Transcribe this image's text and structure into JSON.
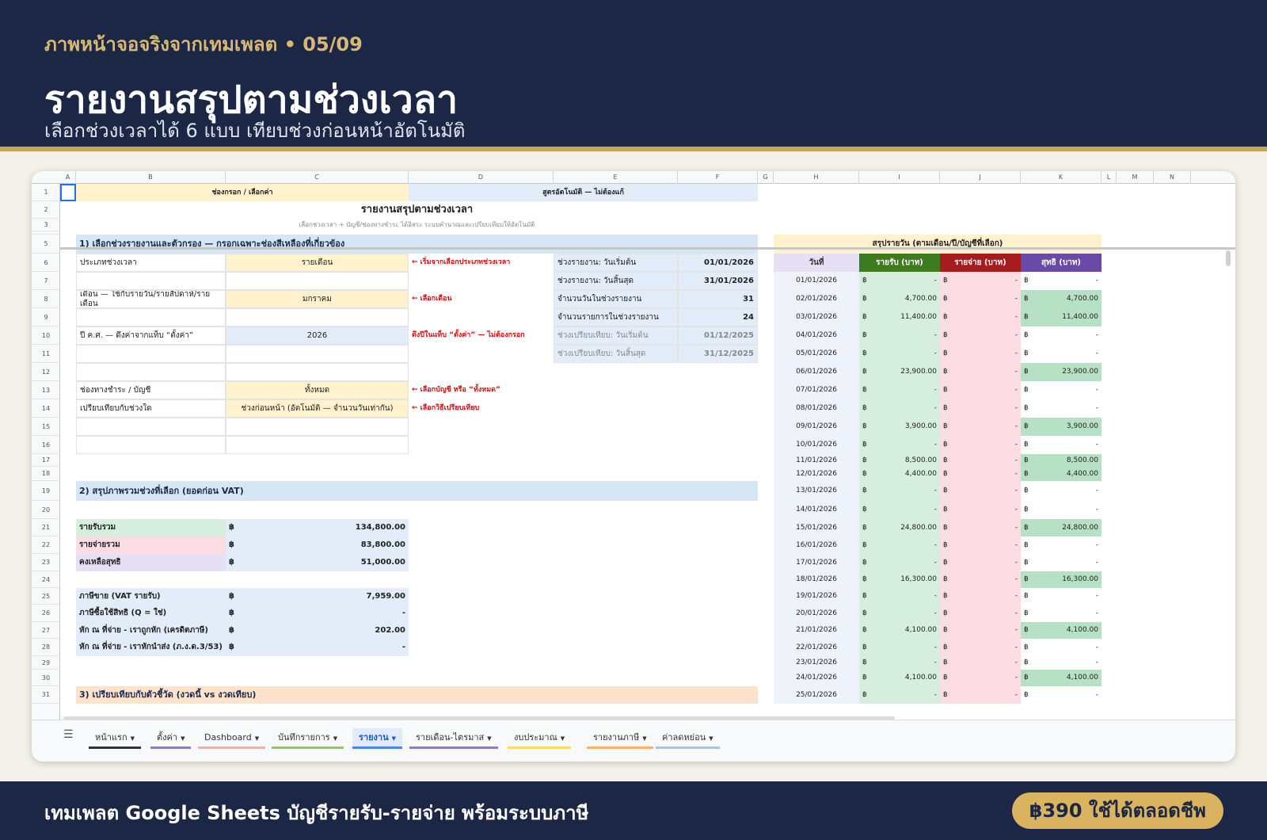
{
  "header": {
    "subtitle": "ภาพหน้าจอจริงจากเทมเพลต",
    "dot": "•",
    "page": "05/09",
    "title": "รายงานสรุปตามช่วงเวลา",
    "desc": "เลือกช่วงเวลาได้ 6 แบบ เทียบช่วงก่อนหน้าอัตโนมัติ"
  },
  "footer": {
    "text": "เทมเพลต Google Sheets บัญชีรายรับ-รายจ่าย พร้อมระบบภาษี",
    "price": "฿390 ใช้ได้ตลอดชีพ"
  },
  "cols": [
    "A",
    "B",
    "C",
    "D",
    "E",
    "F",
    "G",
    "H",
    "I",
    "J",
    "K",
    "L",
    "M",
    "N"
  ],
  "rows": [
    "1",
    "2",
    "3",
    "4",
    "5",
    "6",
    "7",
    "8",
    "9",
    "10",
    "11",
    "12",
    "13",
    "14",
    "15",
    "16",
    "17",
    "18",
    "19",
    "20",
    "21",
    "22",
    "23",
    "24",
    "25",
    "26",
    "27",
    "28",
    "29",
    "30",
    "31"
  ],
  "legend": {
    "input": "ช่องกรอก / เลือกค่า",
    "auto": "สูตรอัตโนมัติ — ไม่ต้องแก้"
  },
  "report": {
    "title": "รายงานสรุปตามช่วงเวลา",
    "hint": "เลือกช่วงเวลา + บัญชี/ช่องทางชำระ ได้อิสระ ระบบคำนวณและเปรียบเทียบให้อัตโนมัติ"
  },
  "s1": {
    "title": "1) เลือกช่วงรายงานและตัวกรอง — กรอกเฉพาะช่องสีเหลืองที่เกี่ยวข้อง",
    "type_label": "ประเภทช่วงเวลา",
    "type_val": "รายเดือน",
    "type_note": "← เริ่มจากเลือกประเภทช่วงเวลา",
    "month_label": "เดือน — ใช้กับรายวัน/รายสัปดาห์/รายเดือน",
    "month_val": "มกราคม",
    "month_note": "← เลือกเดือน",
    "year_label": "ปี ค.ศ. — ดึงค่าจากแท็บ “ตั้งค่า”",
    "year_val": "2026",
    "year_note": "ดึงปีในแท็บ “ตั้งค่า” — ไม่ต้องกรอก",
    "acct_label": "ช่องทางชำระ / บัญชี",
    "acct_val": "ทั้งหมด",
    "acct_note": "← เลือกบัญชี หรือ “ทั้งหมด”",
    "cmp_label": "เปรียบเทียบกับช่วงใด",
    "cmp_val": "ช่วงก่อนหน้า (อัตโนมัติ — จำนวนวันเท่ากัน)",
    "cmp_note": "← เลือกวิธีเปรียบเทียบ"
  },
  "info": [
    {
      "label": "ช่วงรายงาน: วันเริ่มต้น",
      "value": "01/01/2026"
    },
    {
      "label": "ช่วงรายงาน: วันสิ้นสุด",
      "value": "31/01/2026"
    },
    {
      "label": "จำนวนวันในช่วงรายงาน",
      "value": "31"
    },
    {
      "label": "จำนวนรายการในช่วงรายงาน",
      "value": "24"
    },
    {
      "label": "ช่วงเปรียบเทียบ: วันเริ่มต้น",
      "value": "01/12/2025"
    },
    {
      "label": "ช่วงเปรียบเทียบ: วันสิ้นสุด",
      "value": "31/12/2025"
    }
  ],
  "s2": {
    "title": "2) สรุปภาพรวมช่วงที่เลือก (ยอดก่อน VAT)",
    "cur": "฿",
    "income_label": "รายรับรวม",
    "income": "134,800.00",
    "expense_label": "รายจ่ายรวม",
    "expense": "83,800.00",
    "net_label": "คงเหลือสุทธิ",
    "net": "51,000.00",
    "vat_sale_label": "ภาษีขาย (VAT รายรับ)",
    "vat_sale": "7,959.00",
    "vat_buy_label": "ภาษีซื้อใช้สิทธิ (Q = ใช่)",
    "vat_buy": "-",
    "wht1_label": "หัก ณ ที่จ่าย - เราถูกหัก (เครดิตภาษี)",
    "wht1": "202.00",
    "wht2_label": "หัก ณ ที่จ่าย - เราหักนำส่ง (ภ.ง.ด.3/53)",
    "wht2": "-"
  },
  "s3": {
    "title": "3) เปรียบเทียบกับตัวชี้วัด (งวดนี้ vs งวดเทียบ)"
  },
  "daily": {
    "title": "สรุปรายวัน (ตามเดือน/ปี/บัญชีที่เลือก)",
    "h_date": "วันที่",
    "h_inc": "รายรับ (บาท)",
    "h_exp": "รายจ่าย (บาท)",
    "h_net": "สุทธิ (บาท)",
    "cur": "฿",
    "rows": [
      [
        "01/01/2026",
        "-",
        "-",
        "-"
      ],
      [
        "02/01/2026",
        "4,700.00",
        "-",
        "4,700.00"
      ],
      [
        "03/01/2026",
        "11,400.00",
        "-",
        "11,400.00"
      ],
      [
        "04/01/2026",
        "-",
        "-",
        "-"
      ],
      [
        "05/01/2026",
        "-",
        "-",
        "-"
      ],
      [
        "06/01/2026",
        "23,900.00",
        "-",
        "23,900.00"
      ],
      [
        "07/01/2026",
        "-",
        "-",
        "-"
      ],
      [
        "08/01/2026",
        "-",
        "-",
        "-"
      ],
      [
        "09/01/2026",
        "3,900.00",
        "-",
        "3,900.00"
      ],
      [
        "10/01/2026",
        "-",
        "-",
        "-"
      ],
      [
        "11/01/2026",
        "8,500.00",
        "-",
        "8,500.00"
      ],
      [
        "12/01/2026",
        "4,400.00",
        "-",
        "4,400.00"
      ],
      [
        "13/01/2026",
        "-",
        "-",
        "-"
      ],
      [
        "14/01/2026",
        "-",
        "-",
        "-"
      ],
      [
        "15/01/2026",
        "24,800.00",
        "-",
        "24,800.00"
      ],
      [
        "16/01/2026",
        "-",
        "-",
        "-"
      ],
      [
        "17/01/2026",
        "-",
        "-",
        "-"
      ],
      [
        "18/01/2026",
        "16,300.00",
        "-",
        "16,300.00"
      ],
      [
        "19/01/2026",
        "-",
        "-",
        "-"
      ],
      [
        "20/01/2026",
        "-",
        "-",
        "-"
      ],
      [
        "21/01/2026",
        "4,100.00",
        "-",
        "4,100.00"
      ],
      [
        "22/01/2026",
        "-",
        "-",
        "-"
      ],
      [
        "23/01/2026",
        "-",
        "-",
        "-"
      ],
      [
        "24/01/2026",
        "4,100.00",
        "-",
        "4,100.00"
      ],
      [
        "25/01/2026",
        "-",
        "-",
        "-"
      ]
    ]
  },
  "tabs": [
    "หน้าแรก",
    "ตั้งค่า",
    "Dashboard",
    "บันทึกรายการ",
    "รายงาน",
    "รายเดือน-ไตรมาส",
    "งบประมาณ",
    "รายงานภาษี",
    "ค่าลดหย่อน"
  ],
  "tab_colors": [
    "#333333",
    "#8e7cc3",
    "#e6b8a2",
    "#93c47d",
    "#4a86e8",
    "#8e7cc3",
    "#ffd966",
    "#f6b26b",
    "#9fc5e8"
  ],
  "icons": {
    "menu": "menu-icon",
    "dropdown": "chevron-down-icon"
  }
}
